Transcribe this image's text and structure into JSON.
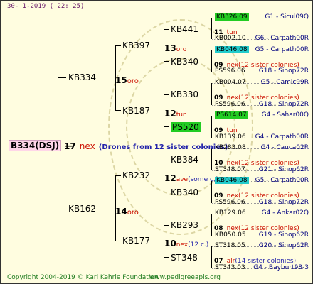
{
  "header": "30-   1-2019  (  22:  25)",
  "root": {
    "id": "B334(DSJ)",
    "year": "17",
    "mate": "nex",
    "note": "(Drones from 12 sister colonies)"
  },
  "g1": [
    {
      "id": "KB334",
      "year": "15",
      "mate": "oro"
    },
    {
      "id": "KB162",
      "year": "14",
      "mate": "oro"
    }
  ],
  "g2": [
    {
      "id": "KB397",
      "year": "13",
      "mate": "oro",
      "note": ""
    },
    {
      "id": "KB187",
      "year": "12",
      "mate": "tun",
      "note": ""
    },
    {
      "id": "KB232",
      "year": "12",
      "mate": "ave",
      "note": "(some c.)"
    },
    {
      "id": "KB177",
      "year": "10",
      "mate": "nex",
      "note": "(12 c.)"
    }
  ],
  "g3": [
    {
      "id": "KB441",
      "year": "11",
      "mate": "tun",
      "note": ""
    },
    {
      "id": "KB340",
      "year": "09",
      "mate": "nex(12 sister colonies)",
      "note": ""
    },
    {
      "id": "KB330",
      "year": "09",
      "mate": "nex(12 sister colonies)",
      "note": ""
    },
    {
      "id": "PS520",
      "year": "09",
      "mate": "tun",
      "note": ""
    },
    {
      "id": "KB384",
      "year": "10",
      "mate": "nex(12 sister colonies)",
      "note": ""
    },
    {
      "id": "KB340",
      "year": "09",
      "mate": "nex(12 sister colonies)",
      "note": ""
    },
    {
      "id": "KB293",
      "year": "08",
      "mate": "nex(12 sister colonies)",
      "note": ""
    },
    {
      "id": "ST348",
      "year": "07",
      "mate": "alr",
      "note": "(14 sister colonies)"
    }
  ],
  "g4": [
    {
      "code": "KB326.09",
      "name": "G1 - Sicul09Q"
    },
    {
      "code": "KB002.10",
      "name": "G6 - Carpath00R"
    },
    {
      "code": "KB046.08",
      "name": "G5 - Carpath00R"
    },
    {
      "code": "PS596.06",
      "name": "G18 - Sinop72R"
    },
    {
      "code": "KB004.07",
      "name": "G5 - Camic99R"
    },
    {
      "code": "PS596.06",
      "name": "G18 - Sinop72R"
    },
    {
      "code": "PS614.07",
      "name": "G4 - Sahar00Q"
    },
    {
      "code": "KB139.06",
      "name": "G4 - Carpath00R"
    },
    {
      "code": "KB283.08",
      "name": "G4 - Cauca02R"
    },
    {
      "code": "ST348.07",
      "name": "G21 - Sinop62R"
    },
    {
      "code": "KB046.08",
      "name": "G5 - Carpath00R"
    },
    {
      "code": "PS596.06",
      "name": "G18 - Sinop72R"
    },
    {
      "code": "KB129.06",
      "name": "G4 - Ankar02Q"
    },
    {
      "code": "KB050.05",
      "name": "G19 - Sinop62R"
    },
    {
      "code": "ST318.05",
      "name": "G20 - Sinop62R"
    },
    {
      "code": "ST343.03",
      "name": "G4 - Bayburt98-3"
    }
  ],
  "footer": {
    "copyright": "Copyright 2004-2019 © Karl Kehrle Foundation",
    "website": "www.pedigreeapis.org"
  }
}
